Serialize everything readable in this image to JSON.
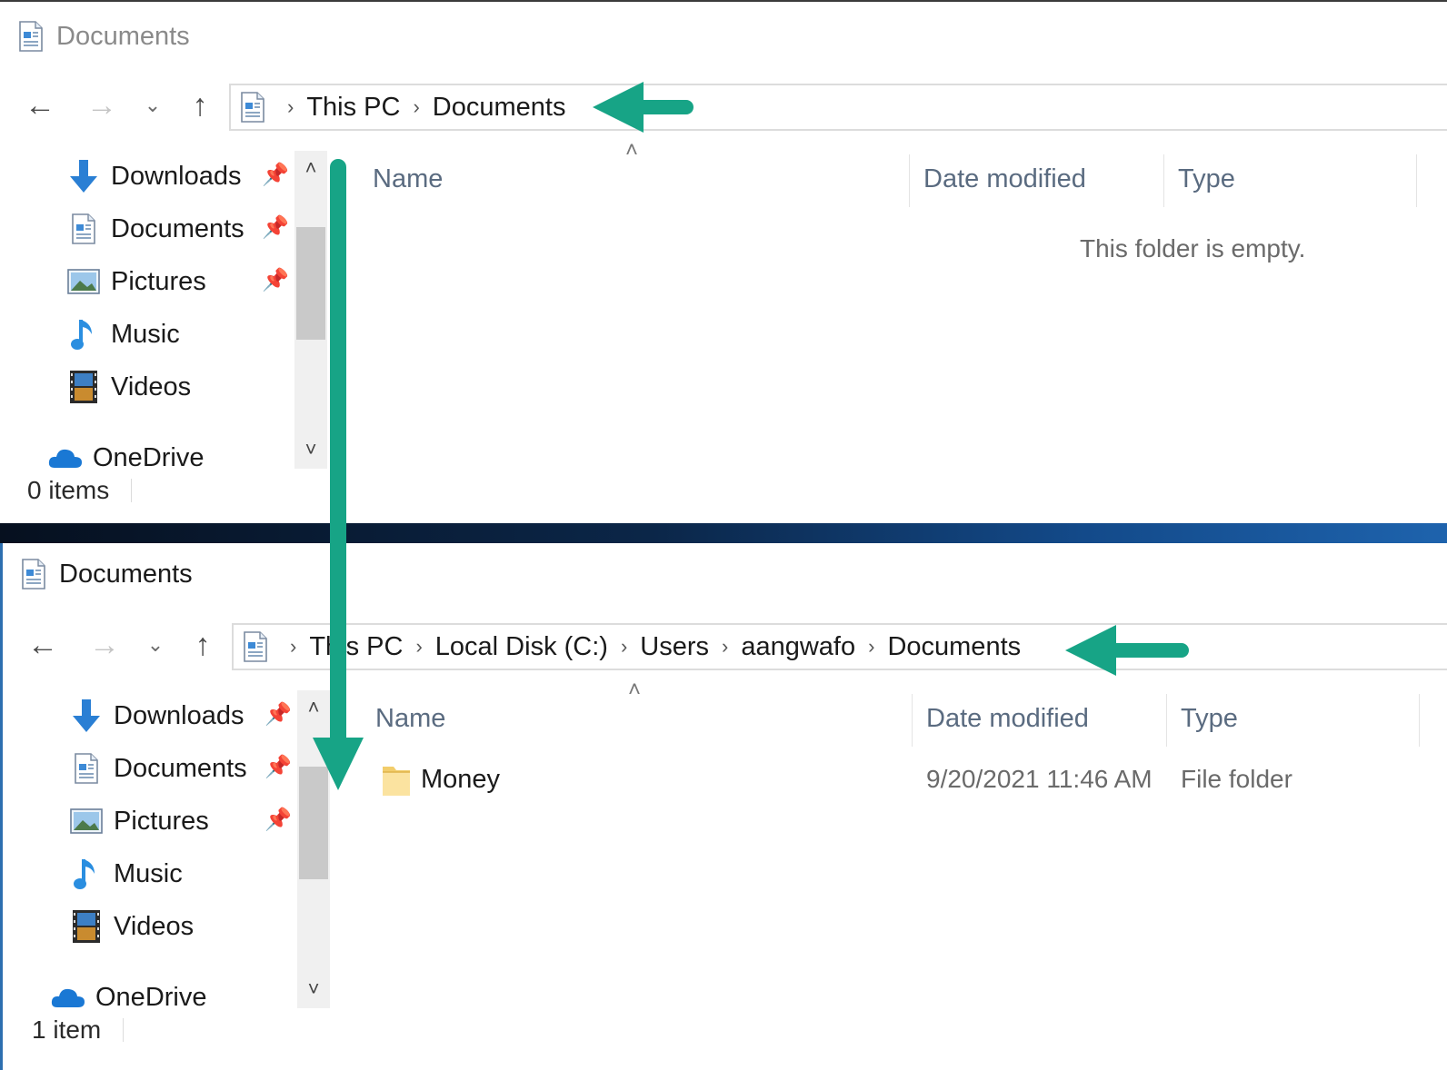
{
  "top_window": {
    "title": "Documents",
    "breadcrumb": [
      "This PC",
      "Documents"
    ],
    "sidebar": {
      "items": [
        {
          "label": "Downloads",
          "icon": "download-icon",
          "pinned": true
        },
        {
          "label": "Documents",
          "icon": "document-icon",
          "pinned": true
        },
        {
          "label": "Pictures",
          "icon": "picture-icon",
          "pinned": true
        },
        {
          "label": "Music",
          "icon": "music-icon",
          "pinned": false
        },
        {
          "label": "Videos",
          "icon": "video-icon",
          "pinned": false
        }
      ],
      "onedrive_label": "OneDrive"
    },
    "columns": {
      "name": "Name",
      "date": "Date modified",
      "type": "Type"
    },
    "empty_message": "This folder is empty.",
    "status": "0 items"
  },
  "bottom_window": {
    "title": "Documents",
    "breadcrumb": [
      "This PC",
      "Local Disk (C:)",
      "Users",
      "aangwafo",
      "Documents"
    ],
    "sidebar": {
      "items": [
        {
          "label": "Downloads",
          "icon": "download-icon",
          "pinned": true
        },
        {
          "label": "Documents",
          "icon": "document-icon",
          "pinned": true
        },
        {
          "label": "Pictures",
          "icon": "picture-icon",
          "pinned": true
        },
        {
          "label": "Music",
          "icon": "music-icon",
          "pinned": false
        },
        {
          "label": "Videos",
          "icon": "video-icon",
          "pinned": false
        }
      ],
      "onedrive_label": "OneDrive"
    },
    "columns": {
      "name": "Name",
      "date": "Date modified",
      "type": "Type"
    },
    "files": [
      {
        "name": "Money",
        "date_modified": "9/20/2021 11:46 AM",
        "type": "File folder",
        "icon": "folder-icon"
      }
    ],
    "status": "1 item"
  },
  "annotation": {
    "arrow_color": "#17a486"
  }
}
